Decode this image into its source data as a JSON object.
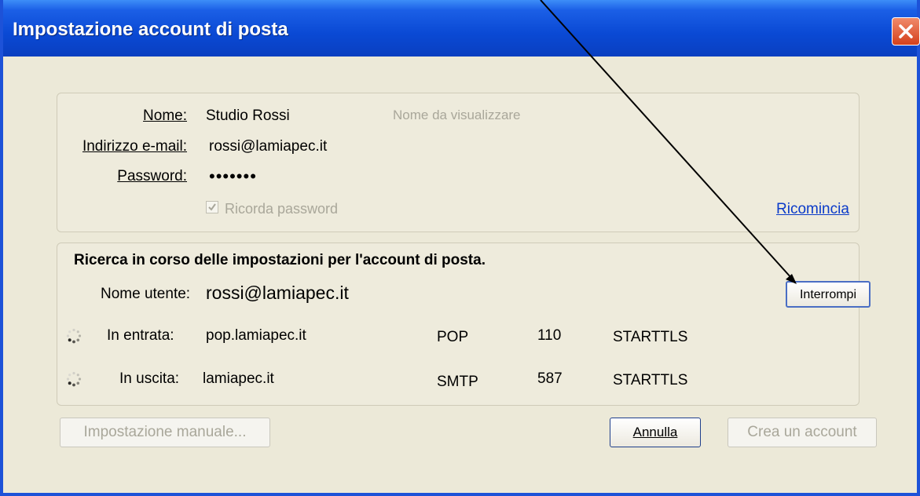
{
  "window": {
    "title": "Impostazione account di posta"
  },
  "account": {
    "name_label": "Nome:",
    "name_value": "Studio Rossi",
    "name_hint": "Nome da visualizzare",
    "email_label": "Indirizzo e-mail:",
    "email_value": "rossi@lamiapec.it",
    "password_label": "Password:",
    "password_value": "•••••••",
    "remember_label": "Ricorda password",
    "restart_link": "Ricomincia"
  },
  "search": {
    "heading": "Ricerca in corso delle impostazioni per l'account di posta.",
    "username_label": "Nome utente:",
    "username_value": "rossi@lamiapec.it",
    "stop_button": "Interrompi",
    "servers": [
      {
        "label": "In entrata:",
        "host": "pop.lamiapec.it",
        "protocol": "POP",
        "port": "110",
        "security": "STARTTLS"
      },
      {
        "label": "In uscita:",
        "host": "lamiapec.it",
        "protocol": "SMTP",
        "port": "587",
        "security": "STARTTLS"
      }
    ]
  },
  "footer": {
    "manual_button": "Impostazione manuale...",
    "cancel_button": "Annulla",
    "create_button": "Crea un account"
  }
}
